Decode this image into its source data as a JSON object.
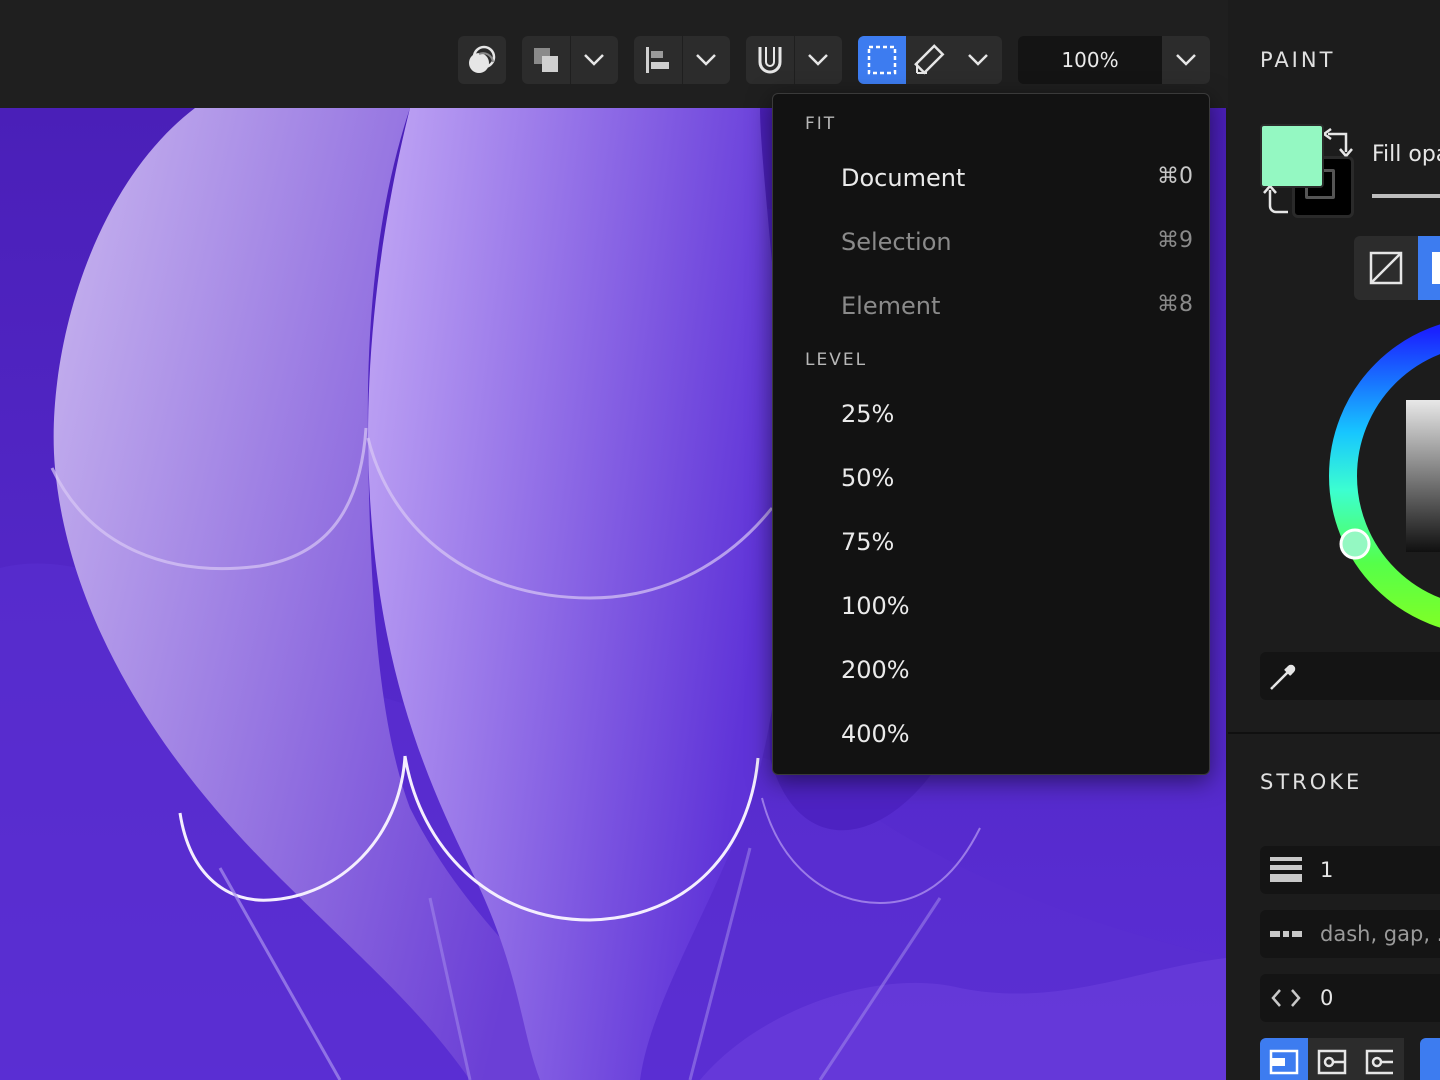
{
  "toolbar": {
    "buttons": [
      {
        "name": "boolean-ops-button",
        "icon": "boolean-intersect-icon"
      },
      {
        "name": "arrange-button",
        "icon": "stack-squares-icon"
      },
      {
        "name": "align-button",
        "icon": "align-left-icon"
      },
      {
        "name": "snap-button",
        "icon": "magnet-icon"
      },
      {
        "name": "selection-mode-button",
        "icon": "marquee-select-icon",
        "active": true
      },
      {
        "name": "measure-button",
        "icon": "ruler-pencil-icon"
      }
    ],
    "zoom_value": "100%"
  },
  "zoom_menu": {
    "fit_heading": "FIT",
    "fit_items": [
      {
        "label": "Document",
        "shortcut": "⌘0",
        "enabled": true
      },
      {
        "label": "Selection",
        "shortcut": "⌘9",
        "enabled": false
      },
      {
        "label": "Element",
        "shortcut": "⌘8",
        "enabled": false
      }
    ],
    "level_heading": "LEVEL",
    "level_items": [
      "25%",
      "50%",
      "75%",
      "100%",
      "200%",
      "400%"
    ]
  },
  "panel": {
    "paint_title": "PAINT",
    "fill_color": "#94f8c2",
    "fill_opacity_label": "Fill opa",
    "stroke_title": "STROKE",
    "stroke_width": "1",
    "dash_placeholder": "dash, gap, ..",
    "offset_value": "0"
  },
  "colors": {
    "accent": "#3d7cf0",
    "canvas_bg": "#5b2fd6"
  }
}
